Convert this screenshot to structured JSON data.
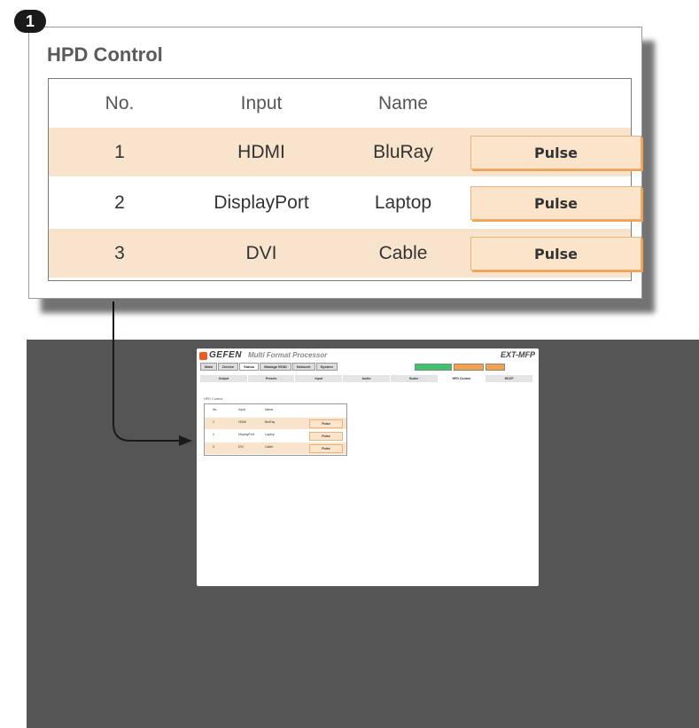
{
  "callout": {
    "number": "1"
  },
  "zoom": {
    "title": "HPD Control",
    "headers": {
      "no": "No.",
      "input": "Input",
      "name": "Name"
    },
    "rows": [
      {
        "no": "1",
        "input": "HDMI",
        "name": "BluRay",
        "button": "Pulse"
      },
      {
        "no": "2",
        "input": "DisplayPort",
        "name": "Laptop",
        "button": "Pulse"
      },
      {
        "no": "3",
        "input": "DVI",
        "name": "Cable",
        "button": "Pulse"
      }
    ]
  },
  "screenshot": {
    "logo": "GEFEN",
    "product": "Multi Format Processor",
    "model": "EXT-MFP",
    "main_tabs": [
      "Main",
      "Device",
      "Status",
      "Manage EDID",
      "Network",
      "System"
    ],
    "status_indicators": [
      "",
      "",
      ""
    ],
    "sub_tabs": [
      "Output",
      "Presets",
      "Input",
      "Audio",
      "Scaler",
      "HPD Control",
      "HDCP"
    ],
    "title": "HPD Control",
    "headers": {
      "no": "No.",
      "input": "Input",
      "name": "Name"
    },
    "rows": [
      {
        "no": "1",
        "input": "HDMI",
        "name": "BluRay",
        "button": "Pulse"
      },
      {
        "no": "2",
        "input": "DisplayPort",
        "name": "Laptop",
        "button": "Pulse"
      },
      {
        "no": "3",
        "input": "DVI",
        "name": "Cable",
        "button": "Pulse"
      }
    ]
  },
  "colors": {
    "row_highlight": "#f8e3cc",
    "button_fill": "#fbe4c9",
    "button_border": "#f3a14a",
    "background_dark": "#555555",
    "badge": "#1a1a1a"
  }
}
